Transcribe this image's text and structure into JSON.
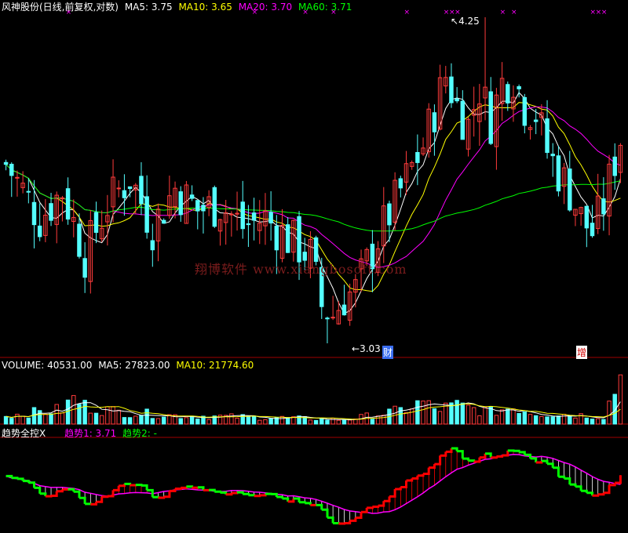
{
  "colors": {
    "up": "#ff3b3b",
    "down": "#54ffff",
    "ma5": "#ffffff",
    "ma10": "#ffff00",
    "ma20": "#ff00ff",
    "ma60": "#00ff00",
    "trend_up": "#ff0000",
    "trend_down": "#00ff00",
    "grid": "#a00000",
    "label": "#ffffff"
  },
  "price_header": {
    "title": "风神股份(日线,前复权,对数)",
    "ma5": "MA5: 3.75",
    "ma10": "MA10: 3.65",
    "ma20": "MA20: 3.70",
    "ma60": "MA60: 3.71"
  },
  "volume_header": {
    "title": "VOLUME: 40531.00",
    "ma5": "MA5: 27823.00",
    "ma10": "MA10: 21774.60"
  },
  "indicator_header": {
    "title": "趋势全控X",
    "trend1": "趋势1: 3.71",
    "trend2": "趋势2: -"
  },
  "annotations": {
    "high": "4.25",
    "low": "3.03",
    "cai": "财",
    "zeng": "增"
  },
  "watermark": "翔博软件 www.xiangbosoft.com",
  "chart_data": {
    "type": "candlestick",
    "price_scale": "log",
    "price_range": [
      3.03,
      4.25
    ],
    "n_bars": 110,
    "price_anchors": [
      [
        0,
        3.65
      ],
      [
        6,
        3.45
      ],
      [
        10,
        3.55
      ],
      [
        14,
        3.32
      ],
      [
        18,
        3.5
      ],
      [
        22,
        3.6
      ],
      [
        26,
        3.42
      ],
      [
        30,
        3.56
      ],
      [
        34,
        3.48
      ],
      [
        38,
        3.5
      ],
      [
        42,
        3.42
      ],
      [
        46,
        3.45
      ],
      [
        50,
        3.38
      ],
      [
        54,
        3.32
      ],
      [
        56,
        3.15
      ],
      [
        58,
        3.12
      ],
      [
        60,
        3.18
      ],
      [
        62,
        3.2
      ],
      [
        66,
        3.38
      ],
      [
        70,
        3.55
      ],
      [
        74,
        3.72
      ],
      [
        78,
        4.0
      ],
      [
        80,
        3.88
      ],
      [
        82,
        3.8
      ],
      [
        84,
        3.95
      ],
      [
        86,
        3.82
      ],
      [
        88,
        3.97
      ],
      [
        90,
        4.0
      ],
      [
        92,
        3.88
      ],
      [
        94,
        3.85
      ],
      [
        96,
        3.7
      ],
      [
        98,
        3.62
      ],
      [
        100,
        3.55
      ],
      [
        102,
        3.45
      ],
      [
        104,
        3.4
      ],
      [
        106,
        3.5
      ],
      [
        109,
        3.75
      ]
    ],
    "volume_anchors": [
      [
        0,
        7000
      ],
      [
        10,
        12000
      ],
      [
        12,
        21000
      ],
      [
        14,
        15000
      ],
      [
        20,
        10000
      ],
      [
        30,
        7000
      ],
      [
        40,
        6000
      ],
      [
        50,
        5000
      ],
      [
        60,
        3500
      ],
      [
        66,
        8000
      ],
      [
        70,
        11000
      ],
      [
        74,
        18000
      ],
      [
        76,
        12000
      ],
      [
        80,
        15000
      ],
      [
        86,
        10000
      ],
      [
        90,
        14000
      ],
      [
        94,
        9000
      ],
      [
        100,
        8000
      ],
      [
        106,
        6000
      ],
      [
        109,
        40531
      ]
    ],
    "volume_range": [
      0,
      42000
    ],
    "trend1_last": 3.71
  }
}
